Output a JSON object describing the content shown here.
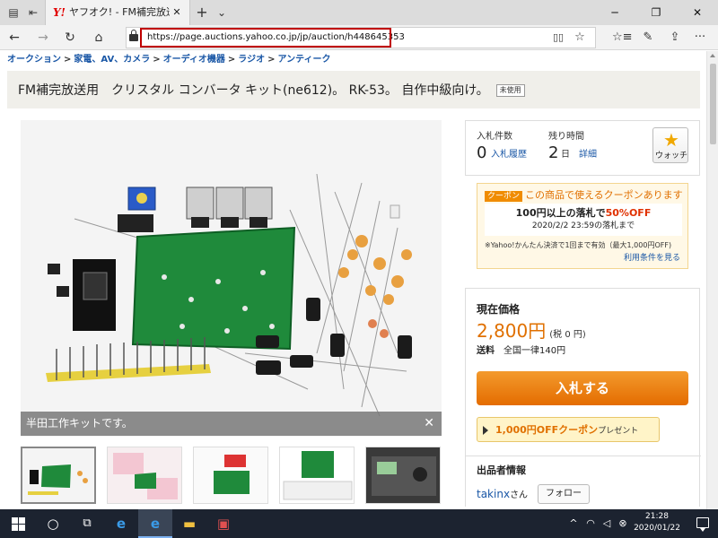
{
  "browser": {
    "tab": {
      "favicon": "Y!",
      "title": "ヤフオク! - FM補完放送用",
      "close": "✕"
    },
    "new_tab": "+",
    "tab_list": "⌄",
    "window": {
      "minimize": "─",
      "restore": "❐",
      "close": "✕"
    },
    "nav": {
      "back": "←",
      "forward": "→",
      "refresh": "↻",
      "home": "⌂"
    },
    "url": "https://page.auctions.yahoo.co.jp/jp/auction/h448645353",
    "url_highlight_color": "#c00000",
    "toolbar_icons": [
      "reading-view-icon",
      "favorite-star-icon",
      "favorites-hub-icon",
      "pen-icon",
      "share-icon",
      "more-icon"
    ]
  },
  "breadcrumb": [
    "オークション",
    "家電、AV、カメラ",
    "オーディオ機器",
    "ラジオ",
    "アンティーク"
  ],
  "breadcrumb_sep": ">",
  "item": {
    "title": "FM補完放送用　クリスタル コンバータ キット(ne612)。 RK-53。 自作中級向け。",
    "condition_badge": "未使用",
    "caption": "半田工作キットです。",
    "caption_close": "✕"
  },
  "bids": {
    "count_label": "入札件数",
    "count": "0",
    "history_link": "入札履歴",
    "time_label": "残り時間",
    "time_value": "2",
    "time_unit": "日",
    "detail_link": "詳細",
    "watch_label": "ウォッチ"
  },
  "coupon": {
    "tag": "クーポン",
    "head": "この商品で使えるクーポンあります",
    "line1_pre": "100円以上の落札で",
    "line1_red": "50%OFF",
    "line2": "2020/2/2 23:59の落札まで",
    "note": "※Yahoo!かんたん決済で1回まで有効（最大1,000円OFF)",
    "terms_link": "利用条件を見る"
  },
  "price": {
    "label": "現在価格",
    "value": "2,800円",
    "tax": "(税 0 円)",
    "shipping_label": "送料",
    "shipping_value": "全国一律140円",
    "bid_button": "入札する",
    "off_coupon": "1,000円OFFクーポン",
    "off_coupon_suffix": "プレゼント"
  },
  "seller": {
    "label": "出品者情報",
    "name": "takinx",
    "suffix": "さん",
    "follow": "フォロー"
  },
  "taskbar": {
    "clock_time": "21:28",
    "clock_date": "2020/01/22"
  },
  "colors": {
    "accent_orange": "#e07000",
    "link_blue": "#1a57a6",
    "bid_button": "#ef8416"
  }
}
